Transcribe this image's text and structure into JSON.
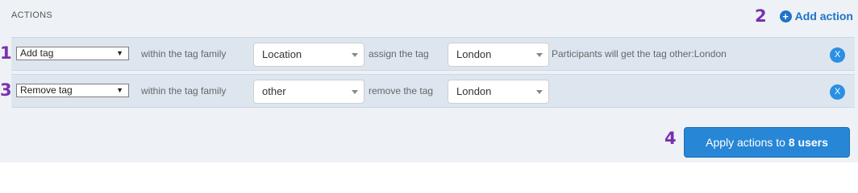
{
  "header": {
    "title": "ACTIONS",
    "add_action_label": "Add action"
  },
  "steps": [
    "1",
    "2",
    "3",
    "4"
  ],
  "rows": [
    {
      "action": "Add tag",
      "family_label": "within the tag family",
      "family_value": "Location",
      "tag_label": "assign the tag",
      "tag_value": "London",
      "note": "Participants will get the tag other:London",
      "remove_label": "X"
    },
    {
      "action": "Remove tag",
      "family_label": "within the tag family",
      "family_value": "other",
      "tag_label": "remove the tag",
      "tag_value": "London",
      "note": "",
      "remove_label": "X"
    }
  ],
  "apply": {
    "prefix": "Apply actions to ",
    "count_text": "8 users"
  },
  "colors": {
    "accent": "#1f73c8",
    "step_marker": "#7a2fb0",
    "apply_button": "#2886d6"
  }
}
